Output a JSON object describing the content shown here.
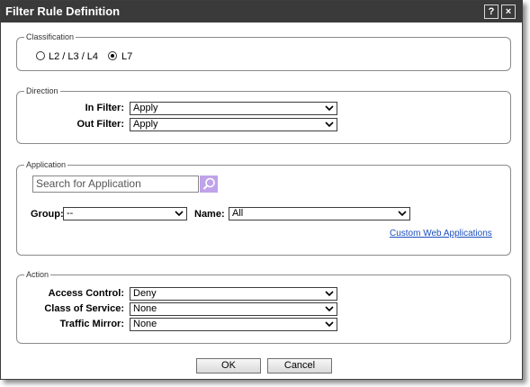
{
  "dialog": {
    "title": "Filter Rule Definition",
    "help_label": "?",
    "close_label": "×"
  },
  "classification": {
    "legend": "Classification",
    "options": [
      {
        "label": "L2 / L3 / L4",
        "selected": false
      },
      {
        "label": "L7",
        "selected": true
      }
    ]
  },
  "direction": {
    "legend": "Direction",
    "in_filter": {
      "label": "In Filter:",
      "value": "Apply"
    },
    "out_filter": {
      "label": "Out Filter:",
      "value": "Apply"
    }
  },
  "application": {
    "legend": "Application",
    "search": {
      "placeholder": "Search for Application",
      "icon": "search-icon"
    },
    "group": {
      "label": "Group:",
      "value": "--"
    },
    "name": {
      "label": "Name:",
      "value": "All"
    },
    "custom_link": "Custom Web Applications"
  },
  "action": {
    "legend": "Action",
    "access_control": {
      "label": "Access Control:",
      "value": "Deny"
    },
    "class_of_service": {
      "label": "Class of Service:",
      "value": "None"
    },
    "traffic_mirror": {
      "label": "Traffic Mirror:",
      "value": "None"
    }
  },
  "buttons": {
    "ok": "OK",
    "cancel": "Cancel"
  },
  "colors": {
    "titlebar": "#3a3a3a",
    "search_button": "#bfa3ea",
    "link": "#1a4fc0"
  }
}
